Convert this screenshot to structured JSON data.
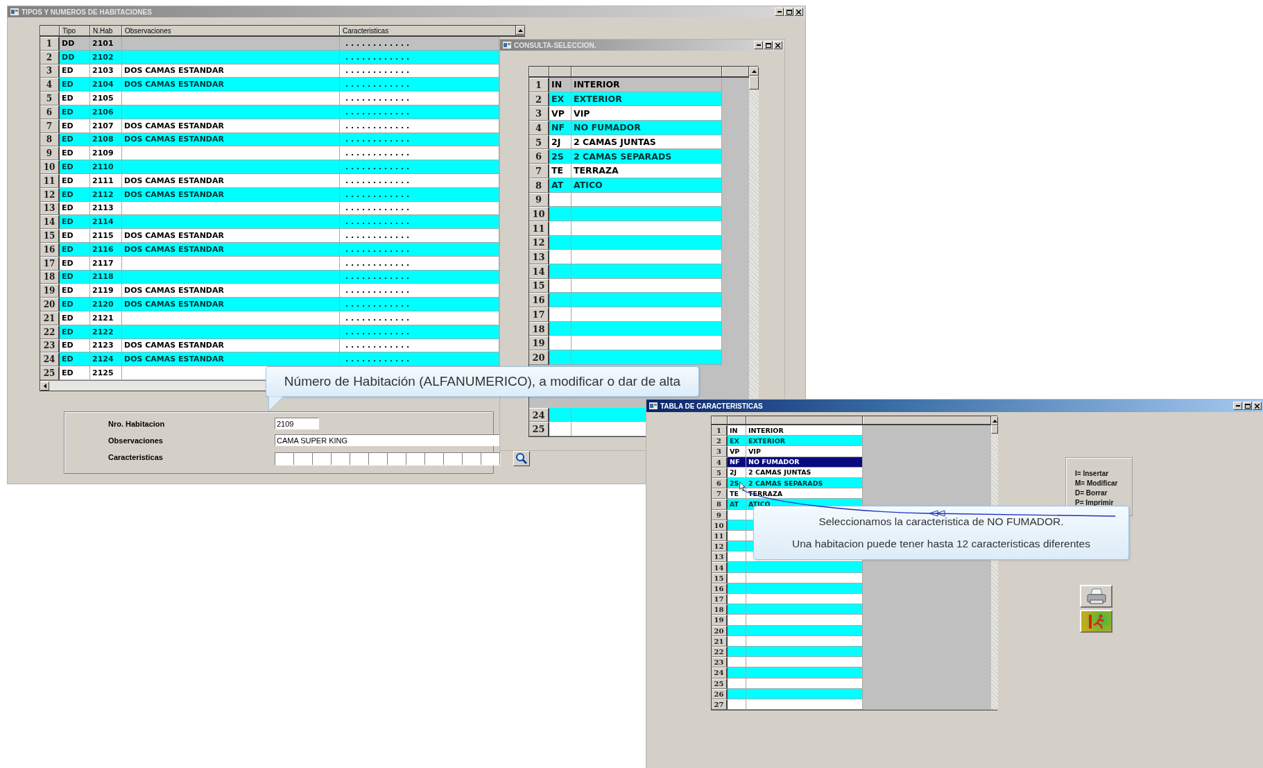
{
  "room_window": {
    "title": "TIPOS Y NUMEROS DE HABITACIONES",
    "active": false,
    "columns": [
      "Tipo",
      "N.Hab",
      "Observaciones",
      "Caracteristicas"
    ],
    "rows": [
      {
        "num": "1",
        "type": "DD",
        "room": "2101",
        "features": ". . . . . . . . . . . .",
        "selected": true
      },
      {
        "num": "2",
        "type": "DD",
        "room": "2102",
        "features": ". . . . . . . . . . . .",
        "selected": false
      },
      {
        "num": "3",
        "type": "ED",
        "room": "2103",
        "notes": "DOS CAMAS ESTANDAR",
        "features": ". . . . . . . . . . . .",
        "selected": false
      },
      {
        "num": "4",
        "type": "ED",
        "room": "2104",
        "notes": "DOS CAMAS ESTANDAR",
        "features": ". . . . . . . . . . . .",
        "selected": false
      },
      {
        "num": "5",
        "type": "ED",
        "room": "2105",
        "features": ". . . . . . . . . . . .",
        "selected": false
      },
      {
        "num": "6",
        "type": "ED",
        "room": "2106",
        "features": ". . . . . . . . . . . .",
        "selected": false
      },
      {
        "num": "7",
        "type": "ED",
        "room": "2107",
        "notes": "DOS CAMAS ESTANDAR",
        "features": ". . . . . . . . . . . .",
        "selected": false
      },
      {
        "num": "8",
        "type": "ED",
        "room": "2108",
        "notes": "DOS CAMAS ESTANDAR",
        "features": ". . . . . . . . . . . .",
        "selected": false
      },
      {
        "num": "9",
        "type": "ED",
        "room": "2109",
        "features": ". . . . . . . . . . . .",
        "selected": false
      },
      {
        "num": "10",
        "type": "ED",
        "room": "2110",
        "features": ". . . . . . . . . . . .",
        "selected": false
      },
      {
        "num": "11",
        "type": "ED",
        "room": "2111",
        "notes": "DOS CAMAS ESTANDAR",
        "features": ". . . . . . . . . . . .",
        "selected": false
      },
      {
        "num": "12",
        "type": "ED",
        "room": "2112",
        "notes": "DOS CAMAS ESTANDAR",
        "features": ". . . . . . . . . . . .",
        "selected": false
      },
      {
        "num": "13",
        "type": "ED",
        "room": "2113",
        "features": ". . . . . . . . . . . .",
        "selected": false
      },
      {
        "num": "14",
        "type": "ED",
        "room": "2114",
        "features": ". . . . . . . . . . . .",
        "selected": false
      },
      {
        "num": "15",
        "type": "ED",
        "room": "2115",
        "notes": "DOS CAMAS ESTANDAR",
        "features": ". . . . . . . . . . . .",
        "selected": false
      },
      {
        "num": "16",
        "type": "ED",
        "room": "2116",
        "notes": "DOS CAMAS ESTANDAR",
        "features": ". . . . . . . . . . . .",
        "selected": false
      },
      {
        "num": "17",
        "type": "ED",
        "room": "2117",
        "features": ". . . . . . . . . . . .",
        "selected": false
      },
      {
        "num": "18",
        "type": "ED",
        "room": "2118",
        "features": ". . . . . . . . . . . .",
        "selected": false
      },
      {
        "num": "19",
        "type": "ED",
        "room": "2119",
        "notes": "DOS CAMAS ESTANDAR",
        "features": ". . . . . . . . . . . .",
        "selected": false
      },
      {
        "num": "20",
        "type": "ED",
        "room": "2120",
        "notes": "DOS CAMAS ESTANDAR",
        "features": ". . . . . . . . . . . .",
        "selected": false
      },
      {
        "num": "21",
        "type": "ED",
        "room": "2121",
        "features": ". . . . . . . . . . . .",
        "selected": false
      },
      {
        "num": "22",
        "type": "ED",
        "room": "2122",
        "features": ". . . . . . . . . . . .",
        "selected": false
      },
      {
        "num": "23",
        "type": "ED",
        "room": "2123",
        "notes": "DOS CAMAS ESTANDAR",
        "features": ". . . . . . . . . . . .",
        "selected": false
      },
      {
        "num": "24",
        "type": "ED",
        "room": "2124",
        "notes": "DOS CAMAS ESTANDAR",
        "features": ". . . . . . . . . . . .",
        "selected": false
      },
      {
        "num": "25",
        "type": "ED",
        "room": "2125",
        "selected": false
      }
    ],
    "form": {
      "fields": [
        {
          "label": "Nro. Habitacion",
          "value": "2109",
          "kind": "short"
        },
        {
          "label": "Observaciones",
          "value": "CAMA SUPER KING",
          "kind": "long"
        },
        {
          "label": "Caracteristicas",
          "kind": "boxes"
        }
      ]
    }
  },
  "tooltip_top": {
    "text": "Número de Habitación (ALFANUMERICO), a modificar o dar de alta"
  },
  "query_window": {
    "title": "CONSULTA-SELECCION.",
    "active": false,
    "rows_top": [
      {
        "num": "1",
        "code": "IN",
        "desc": "INTERIOR",
        "selected": true
      },
      {
        "num": "2",
        "code": "EX",
        "desc": "EXTERIOR",
        "selected": false
      },
      {
        "num": "3",
        "code": "VP",
        "desc": "VIP",
        "selected": false
      },
      {
        "num": "4",
        "code": "NF",
        "desc": "NO FUMADOR",
        "selected": false
      },
      {
        "num": "5",
        "code": "2J",
        "desc": "2 CAMAS JUNTAS",
        "selected": false
      },
      {
        "num": "6",
        "code": "2S",
        "desc": "2 CAMAS SEPARADS",
        "selected": false
      },
      {
        "num": "7",
        "code": "TE",
        "desc": "TERRAZA",
        "selected": false
      },
      {
        "num": "8",
        "code": "AT",
        "desc": "ATICO",
        "selected": false
      },
      {
        "num": "9",
        "selected": false
      },
      {
        "num": "10",
        "selected": false
      },
      {
        "num": "11",
        "selected": false
      },
      {
        "num": "12",
        "selected": false
      },
      {
        "num": "13",
        "selected": false
      },
      {
        "num": "14",
        "selected": false
      },
      {
        "num": "15",
        "selected": false
      },
      {
        "num": "16",
        "selected": false
      },
      {
        "num": "17",
        "selected": false
      },
      {
        "num": "18",
        "selected": false
      },
      {
        "num": "19",
        "selected": false
      },
      {
        "num": "20",
        "selected": false
      }
    ],
    "rows_bottom": [
      {
        "num": "24",
        "selected": false
      },
      {
        "num": "25",
        "selected": false
      }
    ]
  },
  "features_window": {
    "title": "TABLA DE CARACTERISTICAS",
    "active": true,
    "rows": [
      {
        "num": "1",
        "code": "IN",
        "desc": "INTERIOR",
        "selected": false
      },
      {
        "num": "2",
        "code": "EX",
        "desc": "EXTERIOR",
        "selected": false
      },
      {
        "num": "3",
        "code": "VP",
        "desc": "VIP",
        "selected": false
      },
      {
        "num": "4",
        "code": "NF",
        "desc": "NO FUMADOR",
        "selected": true
      },
      {
        "num": "5",
        "code": "2J",
        "desc": "2 CAMAS JUNTAS",
        "selected": false
      },
      {
        "num": "6",
        "code": "2S",
        "desc": "2 CAMAS SEPARADS",
        "selected": false
      },
      {
        "num": "7",
        "code": "TE",
        "desc": "TERRAZA",
        "selected": false
      },
      {
        "num": "8",
        "code": "AT",
        "desc": "ATICO",
        "selected": false
      },
      {
        "num": "9",
        "selected": false
      },
      {
        "num": "10",
        "selected": false
      },
      {
        "num": "11",
        "selected": false
      },
      {
        "num": "12",
        "selected": false
      },
      {
        "num": "13",
        "selected": false
      },
      {
        "num": "14",
        "selected": false
      },
      {
        "num": "15",
        "selected": false
      },
      {
        "num": "16",
        "selected": false
      },
      {
        "num": "17",
        "selected": false
      },
      {
        "num": "18",
        "selected": false
      },
      {
        "num": "19",
        "selected": false
      },
      {
        "num": "20",
        "selected": false
      },
      {
        "num": "21",
        "selected": false
      },
      {
        "num": "22",
        "selected": false
      },
      {
        "num": "23",
        "selected": false
      },
      {
        "num": "24",
        "selected": false
      },
      {
        "num": "25",
        "selected": false
      },
      {
        "num": "26",
        "selected": false
      },
      {
        "num": "27",
        "selected": false
      }
    ],
    "legend": [
      "I= Insertar",
      "M= Modificar",
      "D= Borrar",
      "P= Imprimir"
    ]
  },
  "tooltip_bottom": {
    "lines": [
      "Seleccionamos la caracteristica de NO FUMADOR.",
      "Una habitacion puede tener hasta 12 caracteristicas diferentes"
    ]
  }
}
